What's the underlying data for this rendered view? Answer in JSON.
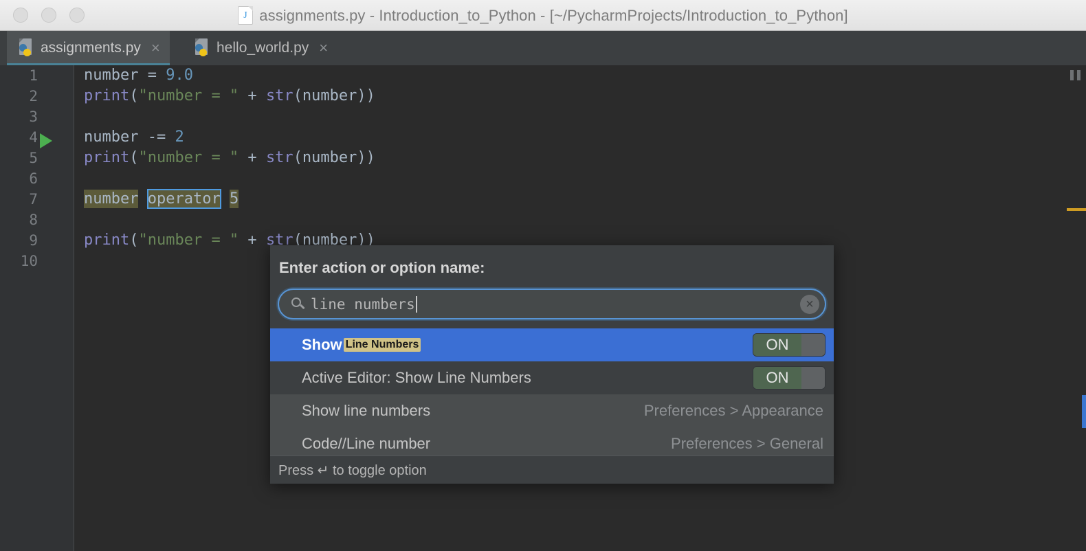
{
  "window": {
    "title": "assignments.py - Introduction_to_Python - [~/PycharmProjects/Introduction_to_Python]",
    "file_icon": "python-document-icon",
    "controls": [
      "close-button",
      "minimize-button",
      "zoom-button"
    ]
  },
  "tabs": [
    {
      "label": "assignments.py",
      "active": true,
      "close": "×",
      "icon": "python-file-icon"
    },
    {
      "label": "hello_world.py",
      "active": false,
      "close": "×",
      "icon": "python-file-icon"
    }
  ],
  "editor": {
    "line_numbers": [
      "1",
      "2",
      "3",
      "4",
      "5",
      "6",
      "7",
      "8",
      "9",
      "10"
    ],
    "run_marker_line": "1",
    "lines": [
      {
        "n": "1",
        "segments": [
          {
            "t": "number ",
            "c": "tok-var"
          },
          {
            "t": "= ",
            "c": "tok-op"
          },
          {
            "t": "9.0",
            "c": "tok-num"
          }
        ]
      },
      {
        "n": "2",
        "segments": [
          {
            "t": "print",
            "c": "tok-fn"
          },
          {
            "t": "(",
            "c": "tok-paren"
          },
          {
            "t": "\"number = \"",
            "c": "tok-str"
          },
          {
            "t": " + ",
            "c": "tok-op"
          },
          {
            "t": "str",
            "c": "tok-fn"
          },
          {
            "t": "(number))",
            "c": "tok-paren"
          }
        ]
      },
      {
        "n": "3",
        "segments": []
      },
      {
        "n": "4",
        "segments": [
          {
            "t": "number ",
            "c": "tok-var"
          },
          {
            "t": "-= ",
            "c": "tok-op"
          },
          {
            "t": "2",
            "c": "tok-num"
          }
        ]
      },
      {
        "n": "5",
        "segments": [
          {
            "t": "print",
            "c": "tok-fn"
          },
          {
            "t": "(",
            "c": "tok-paren"
          },
          {
            "t": "\"number = \"",
            "c": "tok-str"
          },
          {
            "t": " + ",
            "c": "tok-op"
          },
          {
            "t": "str",
            "c": "tok-fn"
          },
          {
            "t": "(number))",
            "c": "tok-paren"
          }
        ]
      },
      {
        "n": "6",
        "segments": []
      },
      {
        "n": "7",
        "segments": [
          {
            "t": "number",
            "c": "hl-box"
          },
          {
            "t": " ",
            "c": "tok-op"
          },
          {
            "t": "operator",
            "c": "hl-outline"
          },
          {
            "t": " ",
            "c": "tok-op"
          },
          {
            "t": "5",
            "c": "hl-box tok-num"
          }
        ]
      },
      {
        "n": "8",
        "segments": []
      },
      {
        "n": "9",
        "segments": [
          {
            "t": "print",
            "c": "tok-fn"
          },
          {
            "t": "(",
            "c": "tok-paren"
          },
          {
            "t": "\"number = \"",
            "c": "tok-str"
          },
          {
            "t": " + ",
            "c": "tok-op"
          },
          {
            "t": "str",
            "c": "tok-fn"
          },
          {
            "t": "(number))",
            "c": "tok-paren"
          }
        ]
      },
      {
        "n": "10",
        "segments": []
      }
    ],
    "pause_icon": "pause-icon",
    "markers": [
      {
        "name": "warning-marker",
        "color": "#cf9c23"
      },
      {
        "name": "caret-position-marker",
        "color": "#3b76d0"
      }
    ]
  },
  "dialog": {
    "title": "Enter action or option name:",
    "search": {
      "value": "line numbers",
      "placeholder": "Enter action or option name",
      "search_icon": "search-icon",
      "clear_icon": "clear-icon",
      "clear_glyph": "×"
    },
    "results": [
      {
        "prefix": "Show ",
        "match": "Line Numbers",
        "right_text": "",
        "toggle": "ON",
        "selected": true
      },
      {
        "prefix": "Active Editor: Show Line Numbers",
        "match": "",
        "right_text": "",
        "toggle": "ON",
        "selected": false
      },
      {
        "prefix": "Show line numbers",
        "match": "",
        "right_text": "Preferences > Appearance",
        "toggle": "",
        "selected": false
      },
      {
        "prefix": "Code//Line number",
        "match": "",
        "right_text": "Preferences > General",
        "toggle": "",
        "selected": false
      }
    ],
    "footer": "Press ↵ to toggle option"
  },
  "colors": {
    "accent_selection": "#3b6fd4",
    "match_highlight": "#d0c287",
    "toggle_on": "#4f6650",
    "editor_bg": "#2b2b2b",
    "panel_bg": "#3c3f41",
    "tab_underline": "#4a8296",
    "run_marker": "#4caf50"
  }
}
